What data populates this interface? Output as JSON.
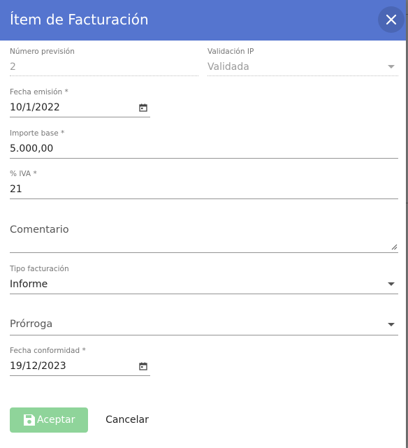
{
  "dialog": {
    "title": "Ítem de Facturación"
  },
  "fields": {
    "numero_prevision": {
      "label": "Número previsión",
      "value": "2"
    },
    "validacion_ip": {
      "label": "Validación IP",
      "value": "Validada"
    },
    "fecha_emision": {
      "label": "Fecha emisión *",
      "value": "10/1/2022"
    },
    "importe_base": {
      "label": "Importe base *",
      "value": "5.000,00"
    },
    "iva": {
      "label": "% IVA *",
      "value": "21"
    },
    "comentario": {
      "placeholder": "Comentario"
    },
    "tipo_facturacion": {
      "label": "Tipo facturación",
      "value": "Informe"
    },
    "prorroga": {
      "placeholder": "Prórroga"
    },
    "fecha_conformidad": {
      "label": "Fecha conformidad *",
      "value": "19/12/2023"
    }
  },
  "actions": {
    "accept_label": "Aceptar",
    "cancel_label": "Cancelar"
  },
  "icons": {
    "close": "close-icon",
    "calendar": "calendar-icon",
    "dropdown": "chevron-down-icon",
    "save": "save-icon"
  },
  "colors": {
    "header": "#5575cf",
    "accept_button": "#8fd49a"
  }
}
